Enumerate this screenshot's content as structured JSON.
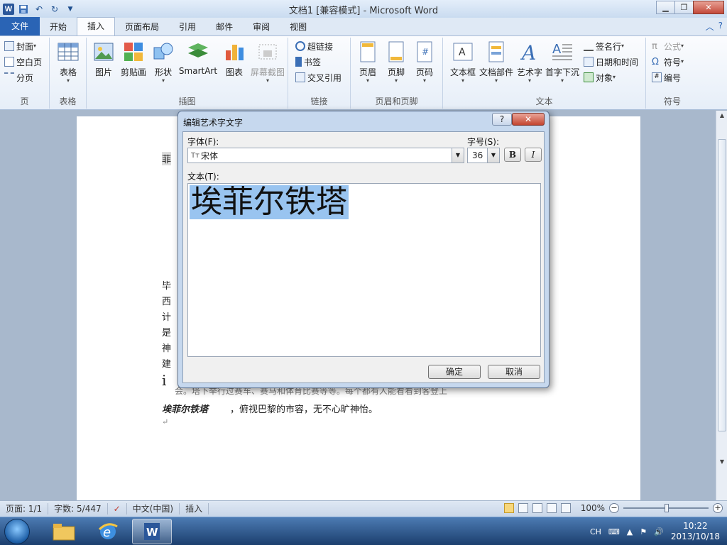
{
  "window": {
    "title": "文档1 [兼容模式] - Microsoft Word"
  },
  "quick_access": {
    "app_icon": "W"
  },
  "tabs": [
    "文件",
    "开始",
    "插入",
    "页面布局",
    "引用",
    "邮件",
    "审阅",
    "视图"
  ],
  "ribbon": {
    "groups": {
      "pages": {
        "label": "页",
        "items": [
          "封面",
          "空白页",
          "分页"
        ]
      },
      "tables": {
        "label": "表格",
        "table": "表格"
      },
      "illustrations": {
        "label": "插图",
        "items": [
          "图片",
          "剪贴画",
          "形状",
          "SmartArt",
          "图表",
          "屏幕截图"
        ]
      },
      "links": {
        "label": "链接",
        "items": [
          "超链接",
          "书签",
          "交叉引用"
        ]
      },
      "header_footer": {
        "label": "页眉和页脚",
        "items": [
          "页眉",
          "页脚",
          "页码"
        ]
      },
      "text": {
        "label": "文本",
        "items": [
          "文本框",
          "文档部件",
          "艺术字",
          "首字下沉"
        ],
        "small_items": [
          "签名行",
          "日期和时间",
          "对象"
        ]
      },
      "symbols": {
        "label": "符号",
        "items": [
          "公式",
          "符号",
          "编号"
        ]
      }
    }
  },
  "document": {
    "lines": [
      "菲",
      "毕",
      "西",
      "计",
      "是",
      "神",
      "建",
      "i"
    ],
    "bold_phrase": "埃菲尔铁塔",
    "tail": "，俯视巴黎的市容，无不心旷神怡。",
    "paragraph_mark": "↵",
    "hidden_line": "会。塔下举行过赛车、赛马和体育比赛等等。每个都有人能看看到客登上"
  },
  "dialog": {
    "title": "编辑艺术字文字",
    "help": "?",
    "close": "✕",
    "font_label": "字体(F):",
    "font_value": "宋体",
    "size_label": "字号(S):",
    "size_value": "36",
    "bold": "B",
    "italic": "I",
    "text_label": "文本(T):",
    "text_value": "埃菲尔铁塔",
    "ok": "确定",
    "cancel": "取消"
  },
  "status": {
    "page": "页面: 1/1",
    "words": "字数: 5/447",
    "language": "中文(中国)",
    "mode": "插入",
    "zoom": "100%"
  },
  "taskbar": {
    "ime": "CH",
    "time": "10:22",
    "date": "2013/10/18"
  }
}
